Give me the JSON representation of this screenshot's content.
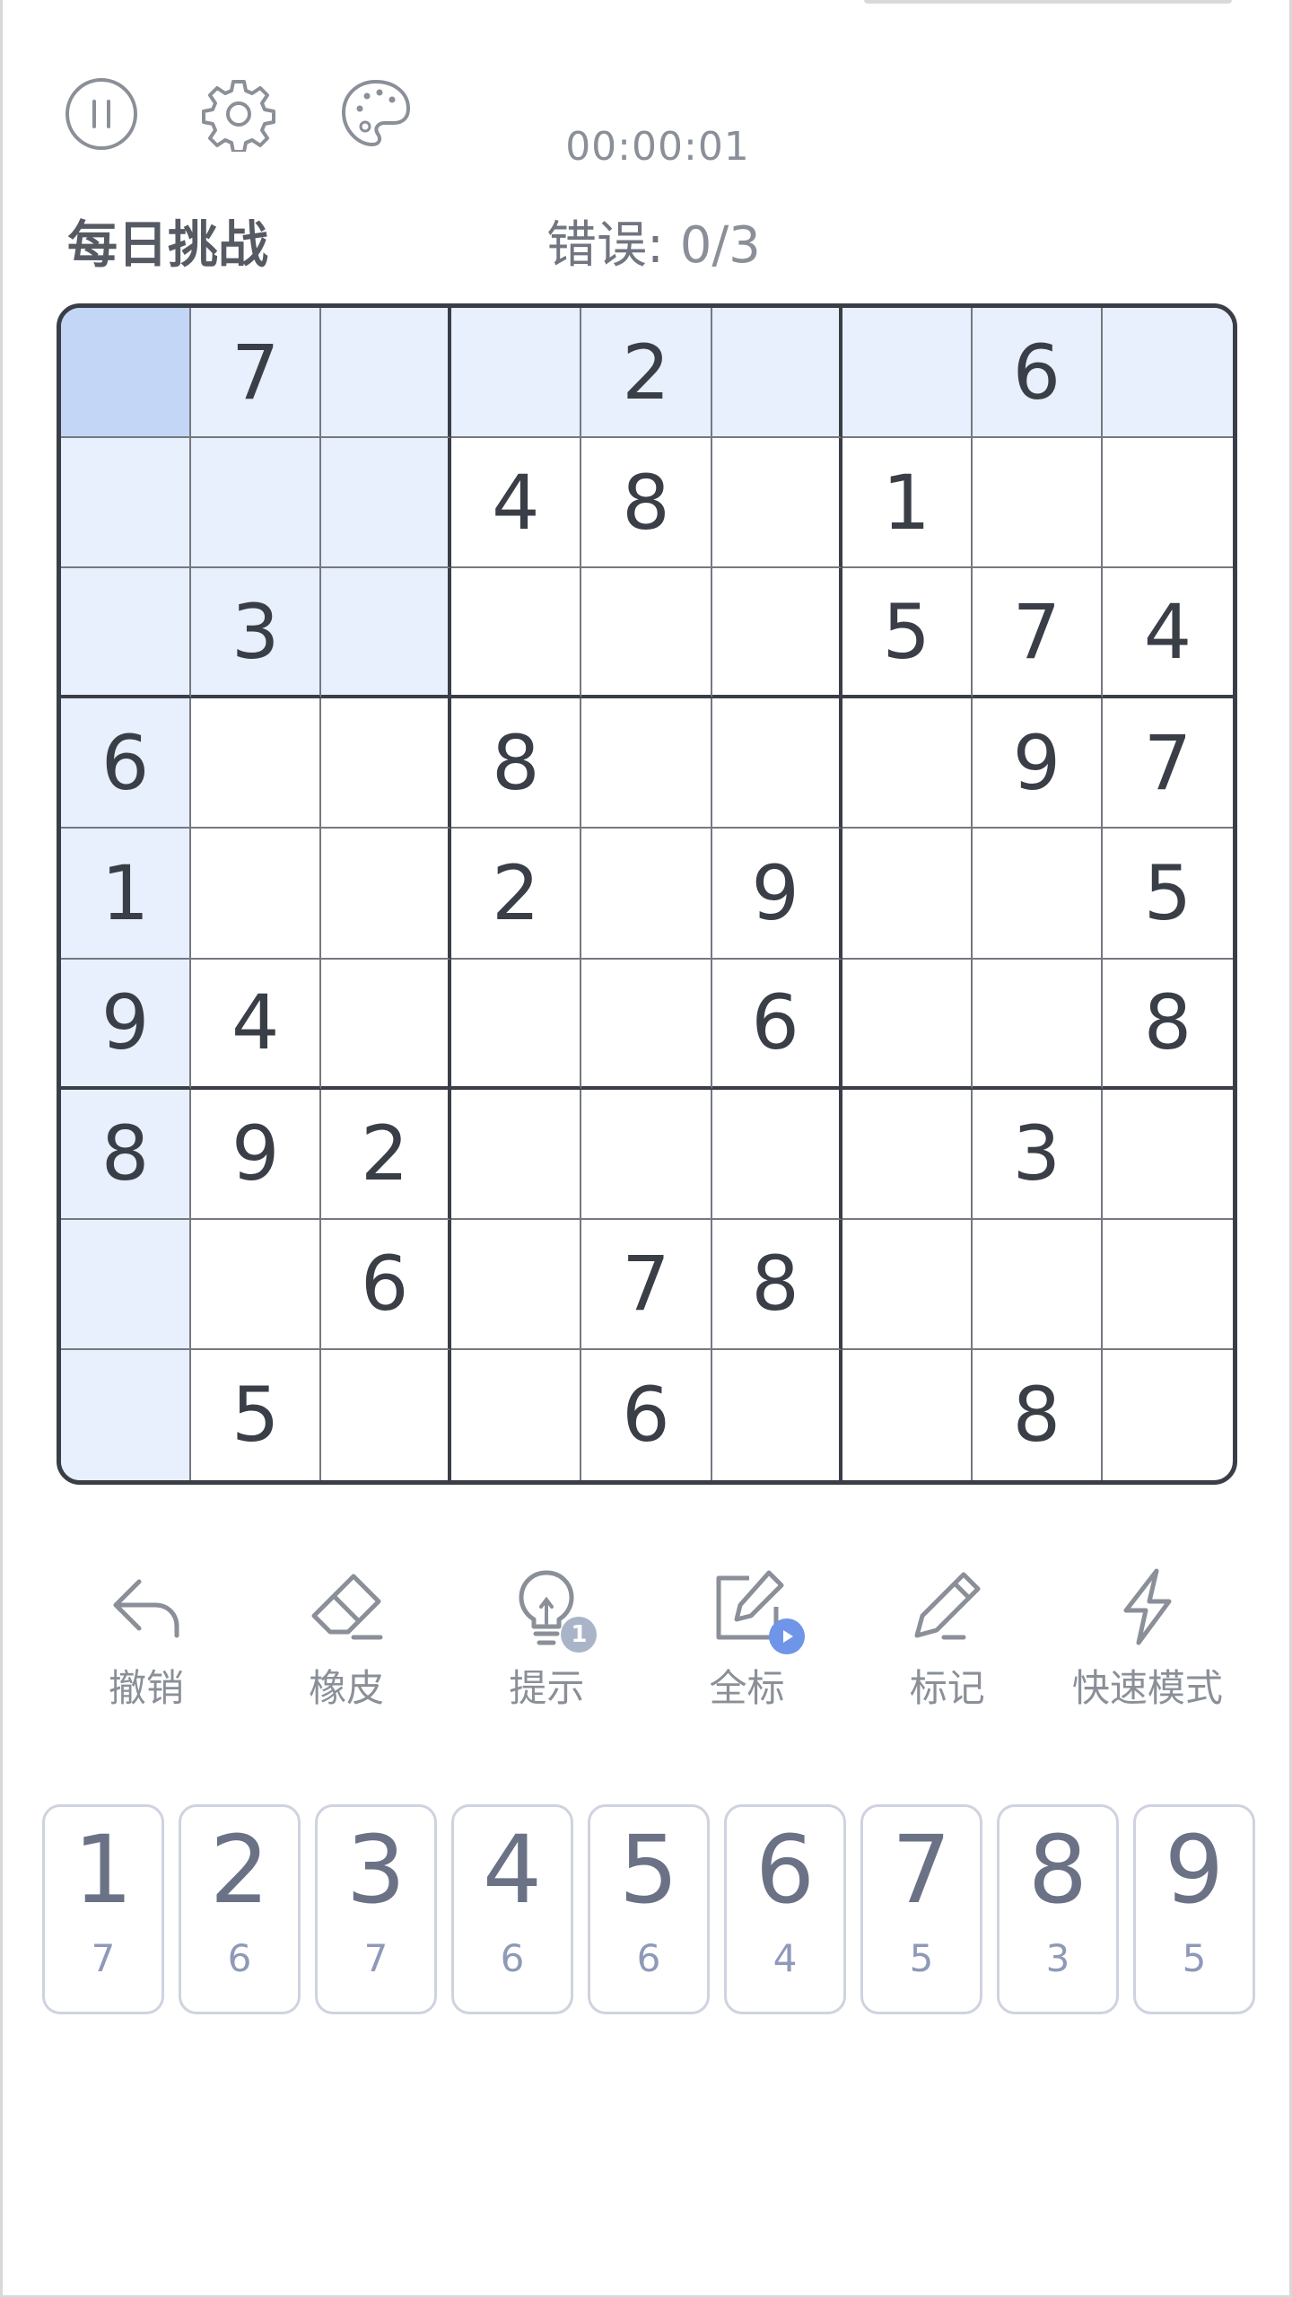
{
  "header": {
    "icons": [
      "pause-icon",
      "gear-icon",
      "palette-icon"
    ],
    "timer": "00:00:01",
    "mode_label": "每日挑战",
    "mistakes_label": "错误:",
    "mistakes_value": "0/3"
  },
  "board": {
    "selected": [
      0,
      0
    ],
    "cells": [
      [
        "",
        "7",
        "",
        "",
        "2",
        "",
        "",
        "6",
        ""
      ],
      [
        "",
        "",
        "",
        "4",
        "8",
        "",
        "1",
        "",
        ""
      ],
      [
        "",
        "3",
        "",
        "",
        "",
        "",
        "5",
        "7",
        "4"
      ],
      [
        "6",
        "",
        "",
        "8",
        "",
        "",
        "",
        "9",
        "7"
      ],
      [
        "1",
        "",
        "",
        "2",
        "",
        "9",
        "",
        "",
        "5"
      ],
      [
        "9",
        "4",
        "",
        "",
        "",
        "6",
        "",
        "",
        "8"
      ],
      [
        "8",
        "9",
        "2",
        "",
        "",
        "",
        "",
        "3",
        ""
      ],
      [
        "",
        "",
        "6",
        "",
        "7",
        "8",
        "",
        "",
        ""
      ],
      [
        "",
        "5",
        "",
        "",
        "6",
        "",
        "",
        "8",
        ""
      ]
    ]
  },
  "actions": [
    {
      "label": "撤销",
      "icon": "undo-icon"
    },
    {
      "label": "橡皮",
      "icon": "eraser-icon"
    },
    {
      "label": "提示",
      "icon": "lightbulb-icon",
      "badge": "1"
    },
    {
      "label": "全标",
      "icon": "edit-all-icon"
    },
    {
      "label": "标记",
      "icon": "pencil-icon"
    },
    {
      "label": "快速模式",
      "icon": "lightning-icon"
    }
  ],
  "numpad": [
    {
      "digit": "1",
      "remaining": "7"
    },
    {
      "digit": "2",
      "remaining": "6"
    },
    {
      "digit": "3",
      "remaining": "7"
    },
    {
      "digit": "4",
      "remaining": "6"
    },
    {
      "digit": "5",
      "remaining": "6"
    },
    {
      "digit": "6",
      "remaining": "4"
    },
    {
      "digit": "7",
      "remaining": "5"
    },
    {
      "digit": "8",
      "remaining": "3"
    },
    {
      "digit": "9",
      "remaining": "5"
    }
  ],
  "colors": {
    "highlight": "#e8effd",
    "selected": "#c3d6f6",
    "accent": "#6f95e8"
  }
}
